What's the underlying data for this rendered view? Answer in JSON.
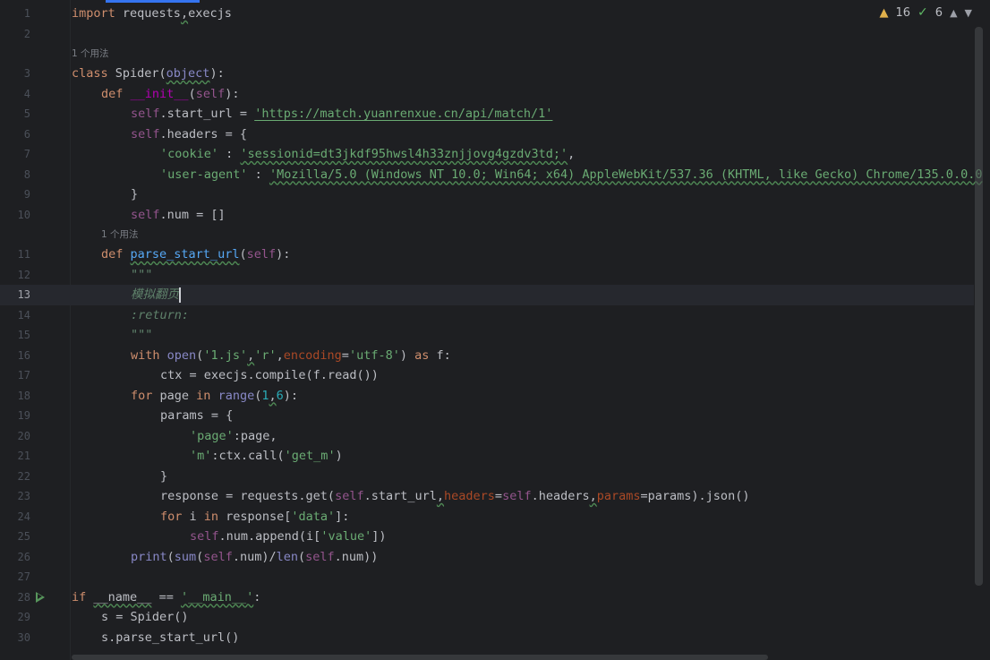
{
  "editor": {
    "line_numbers": [
      "1",
      "2",
      "3",
      "4",
      "5",
      "6",
      "7",
      "8",
      "9",
      "10",
      "11",
      "12",
      "13",
      "14",
      "15",
      "16",
      "17",
      "18",
      "19",
      "20",
      "21",
      "22",
      "23",
      "24",
      "25",
      "26",
      "27",
      "28",
      "29",
      "30"
    ],
    "usage_hint": "1 个用法",
    "inspections": {
      "warnings": "16",
      "ok": "6"
    },
    "code": {
      "l1": [
        "import",
        " requests",
        ",",
        "execjs"
      ],
      "l3": [
        "class",
        " Spider(",
        "object",
        "):"
      ],
      "l4": [
        "def",
        " ",
        "__init__",
        "(",
        "self",
        "):"
      ],
      "l5": [
        "self",
        ".start_url = ",
        "'https://match.yuanrenxue.cn/api/match/1'"
      ],
      "l6": [
        "self",
        ".headers = {"
      ],
      "l7": [
        "'cookie'",
        " : ",
        "'sessionid=dt3jkdf95hwsl4h33znjjovg4gzdv3td;'",
        ","
      ],
      "l8": [
        "'user-agent'",
        " : ",
        "'Mozilla/5.0 (Windows NT 10.0; Win64; x64) AppleWebKit/537.36 (KHTML, like Gecko) Chrome/135.0.0.0"
      ],
      "l9": [
        "}"
      ],
      "l10": [
        "self",
        ".num = []"
      ],
      "l11": [
        "def",
        " ",
        "parse_start_url",
        "(",
        "self",
        "):"
      ],
      "l12": [
        "\"\"\""
      ],
      "l13": [
        "模拟翻页"
      ],
      "l14": [
        ":return:"
      ],
      "l15": [
        "\"\"\""
      ],
      "l16": [
        "with",
        " ",
        "open",
        "(",
        "'1.js'",
        ",",
        "'r'",
        ",",
        "encoding",
        "=",
        "'utf-8'",
        ") ",
        "as",
        " f:"
      ],
      "l17": [
        "ctx = execjs.compile(f.read())"
      ],
      "l18": [
        "for",
        " page ",
        "in",
        " ",
        "range",
        "(",
        "1",
        ",",
        "6",
        "):"
      ],
      "l19": [
        "params = {"
      ],
      "l20": [
        "'page'",
        ":page,"
      ],
      "l21": [
        "'m'",
        ":ctx.call(",
        "'get_m'",
        ")"
      ],
      "l22": [
        "}"
      ],
      "l23": [
        "response = requests.get(",
        "self",
        ".start_url",
        ",",
        "headers",
        "=",
        "self",
        ".headers",
        ",",
        "params",
        "=params).json()"
      ],
      "l24": [
        "for",
        " i ",
        "in",
        " response[",
        "'data'",
        "]:"
      ],
      "l25": [
        "self",
        ".num.append(i[",
        "'value'",
        "])"
      ],
      "l26": [
        "print",
        "(",
        "sum",
        "(",
        "self",
        ".num)/",
        "len",
        "(",
        "self",
        ".num))"
      ],
      "l28": [
        "if",
        " ",
        "__name__",
        " == ",
        "'__main__'",
        ":"
      ],
      "l29": [
        "s = Spider()"
      ],
      "l30": [
        "s.parse_start_url()"
      ]
    }
  }
}
